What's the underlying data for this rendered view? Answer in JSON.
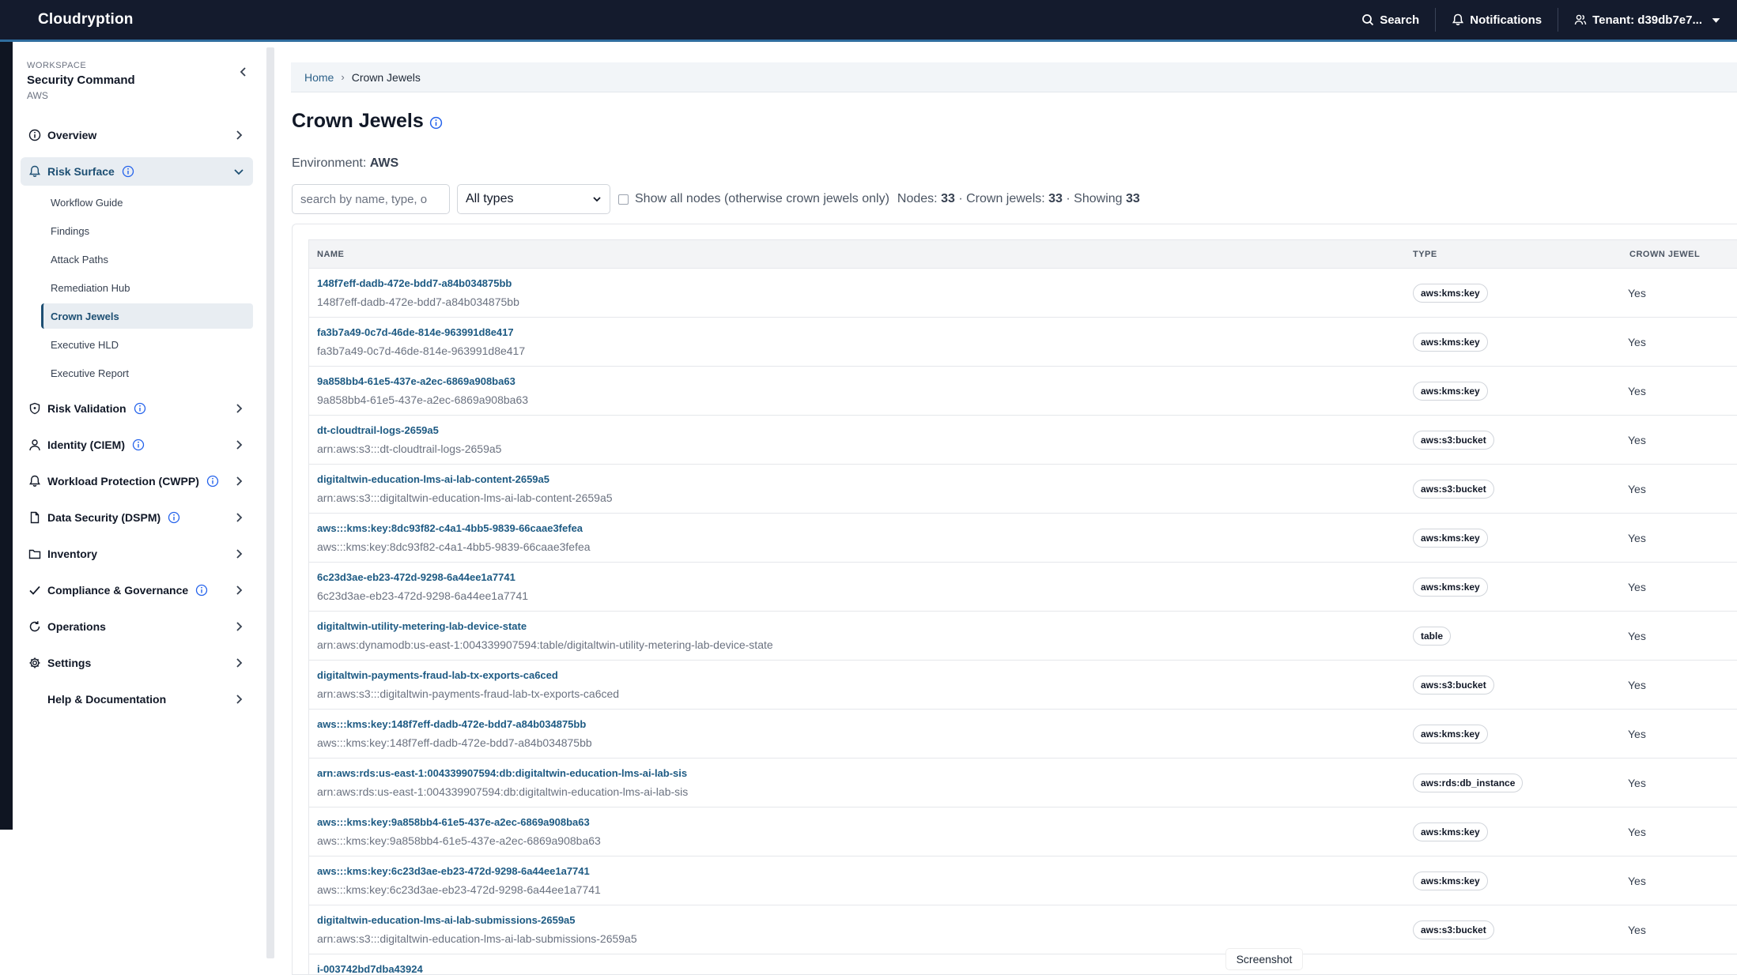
{
  "app": {
    "brand": "Cloudryption",
    "search_label": "Search",
    "notifications_label": "Notifications",
    "tenant_label": "Tenant: d39db7e7..."
  },
  "workspace": {
    "label": "WORKSPACE",
    "name": "Security Command",
    "sub": "AWS"
  },
  "nav": {
    "overview": "Overview",
    "risk_surface": "Risk Surface",
    "risk_surface_items": [
      "Workflow Guide",
      "Findings",
      "Attack Paths",
      "Remediation Hub",
      "Crown Jewels",
      "Executive HLD",
      "Executive Report"
    ],
    "risk_validation": "Risk Validation",
    "identity": "Identity (CIEM)",
    "workload": "Workload Protection (CWPP)",
    "data_security": "Data Security (DSPM)",
    "inventory": "Inventory",
    "compliance": "Compliance & Governance",
    "operations": "Operations",
    "settings": "Settings",
    "help": "Help & Documentation"
  },
  "breadcrumb": {
    "home": "Home",
    "separator": "›",
    "current": "Crown Jewels"
  },
  "page": {
    "title": "Crown Jewels",
    "env_label": "Environment:",
    "env_value": "AWS",
    "search_placeholder": "search by name, type, o",
    "type_filter": "All types",
    "show_all_label": "Show all nodes (otherwise crown jewels only)",
    "nodes_label": "Nodes:",
    "nodes_count": "33",
    "crown_label": "· Crown jewels:",
    "crown_count": "33",
    "showing_label": "· Showing",
    "showing_count": "33"
  },
  "table": {
    "headers": {
      "name": "NAME",
      "type": "TYPE",
      "crown": "CROWN JEWEL"
    },
    "rows": [
      {
        "name": "148f7eff-dadb-472e-bdd7-a84b034875bb",
        "id": "148f7eff-dadb-472e-bdd7-a84b034875bb",
        "type": "aws:kms:key",
        "crown": "Yes"
      },
      {
        "name": "fa3b7a49-0c7d-46de-814e-963991d8e417",
        "id": "fa3b7a49-0c7d-46de-814e-963991d8e417",
        "type": "aws:kms:key",
        "crown": "Yes"
      },
      {
        "name": "9a858bb4-61e5-437e-a2ec-6869a908ba63",
        "id": "9a858bb4-61e5-437e-a2ec-6869a908ba63",
        "type": "aws:kms:key",
        "crown": "Yes"
      },
      {
        "name": "dt-cloudtrail-logs-2659a5",
        "id": "arn:aws:s3:::dt-cloudtrail-logs-2659a5",
        "type": "aws:s3:bucket",
        "crown": "Yes"
      },
      {
        "name": "digitaltwin-education-lms-ai-lab-content-2659a5",
        "id": "arn:aws:s3:::digitaltwin-education-lms-ai-lab-content-2659a5",
        "type": "aws:s3:bucket",
        "crown": "Yes"
      },
      {
        "name": "aws:::kms:key:8dc93f82-c4a1-4bb5-9839-66caae3fefea",
        "id": "aws:::kms:key:8dc93f82-c4a1-4bb5-9839-66caae3fefea",
        "type": "aws:kms:key",
        "crown": "Yes"
      },
      {
        "name": "6c23d3ae-eb23-472d-9298-6a44ee1a7741",
        "id": "6c23d3ae-eb23-472d-9298-6a44ee1a7741",
        "type": "aws:kms:key",
        "crown": "Yes"
      },
      {
        "name": "digitaltwin-utility-metering-lab-device-state",
        "id": "arn:aws:dynamodb:us-east-1:004339907594:table/digitaltwin-utility-metering-lab-device-state",
        "type": "table",
        "crown": "Yes"
      },
      {
        "name": "digitaltwin-payments-fraud-lab-tx-exports-ca6ced",
        "id": "arn:aws:s3:::digitaltwin-payments-fraud-lab-tx-exports-ca6ced",
        "type": "aws:s3:bucket",
        "crown": "Yes"
      },
      {
        "name": "aws:::kms:key:148f7eff-dadb-472e-bdd7-a84b034875bb",
        "id": "aws:::kms:key:148f7eff-dadb-472e-bdd7-a84b034875bb",
        "type": "aws:kms:key",
        "crown": "Yes"
      },
      {
        "name": "arn:aws:rds:us-east-1:004339907594:db:digitaltwin-education-lms-ai-lab-sis",
        "id": "arn:aws:rds:us-east-1:004339907594:db:digitaltwin-education-lms-ai-lab-sis",
        "type": "aws:rds:db_instance",
        "crown": "Yes"
      },
      {
        "name": "aws:::kms:key:9a858bb4-61e5-437e-a2ec-6869a908ba63",
        "id": "aws:::kms:key:9a858bb4-61e5-437e-a2ec-6869a908ba63",
        "type": "aws:kms:key",
        "crown": "Yes"
      },
      {
        "name": "aws:::kms:key:6c23d3ae-eb23-472d-9298-6a44ee1a7741",
        "id": "aws:::kms:key:6c23d3ae-eb23-472d-9298-6a44ee1a7741",
        "type": "aws:kms:key",
        "crown": "Yes"
      },
      {
        "name": "digitaltwin-education-lms-ai-lab-submissions-2659a5",
        "id": "arn:aws:s3:::digitaltwin-education-lms-ai-lab-submissions-2659a5",
        "type": "aws:s3:bucket",
        "crown": "Yes"
      },
      {
        "name": "i-003742bd7dba43924",
        "id": "",
        "type": "",
        "crown": ""
      }
    ]
  },
  "tooltip": "Screenshot"
}
